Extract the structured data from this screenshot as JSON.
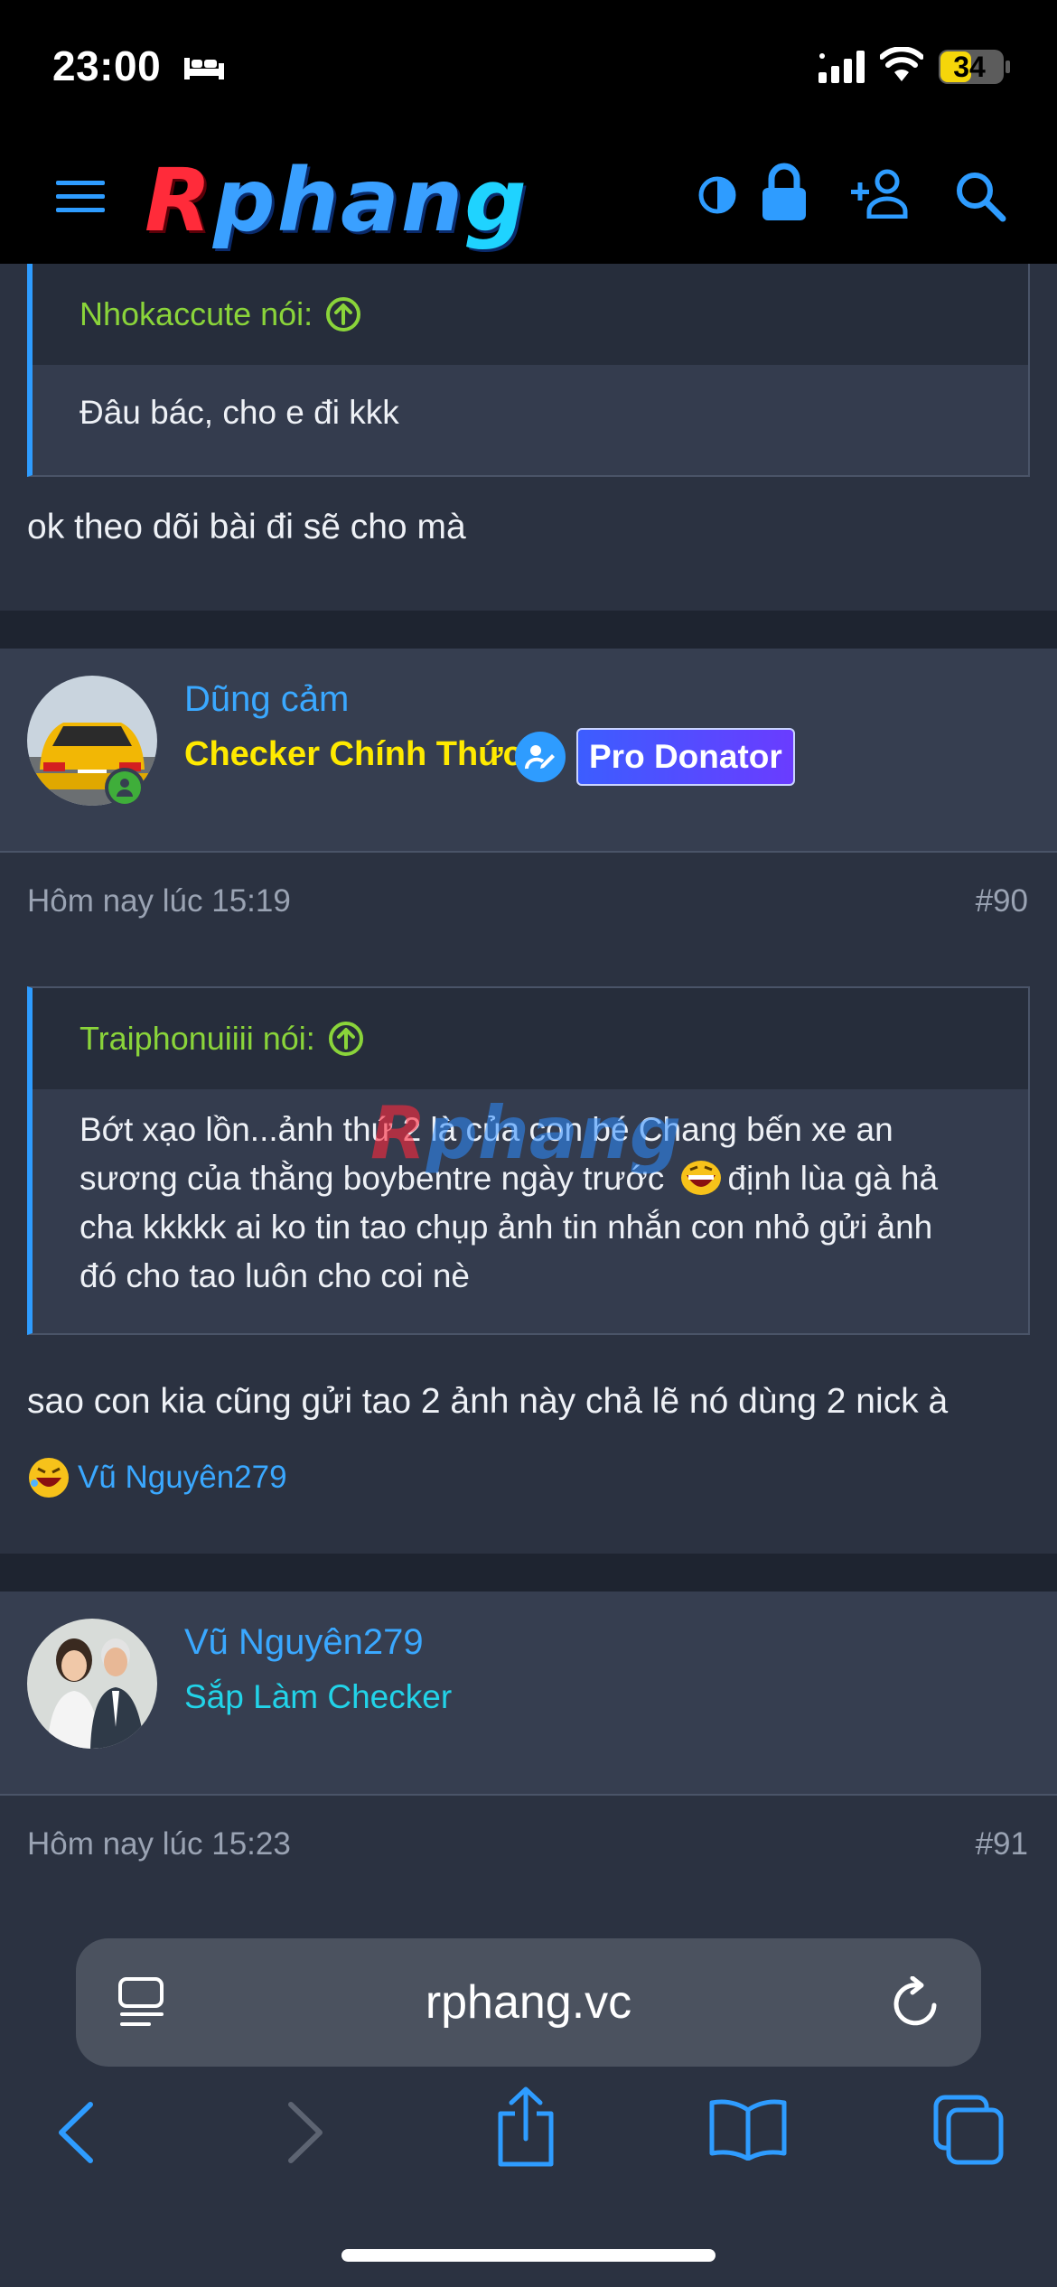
{
  "status_bar": {
    "time": "23:00",
    "battery": "34"
  },
  "nav": {
    "logo_r": "R",
    "logo_mid": "phan",
    "logo_g": "g",
    "icons": [
      "menu-icon",
      "theme-toggle-icon",
      "lock-icon",
      "add-user-icon",
      "search-icon"
    ]
  },
  "post1": {
    "quote_author": "Nhokaccute nói:",
    "quote_text": "Đâu bác, cho e đi kkk",
    "text": "ok theo dõi bài đi sẽ cho mà"
  },
  "post2": {
    "username": "Dũng cảm",
    "user_title": "Checker Chính Thức",
    "badge": "Pro Donator",
    "date": "Hôm nay lúc 15:19",
    "number": "#90",
    "quote_author": "Traiphonuiiii nói:",
    "quote_text_1": "Bớt xạo lồn...ảnh thứ 2 là của con bé Chang bến xe an",
    "quote_text_2a": "sương của thằng boybentre ngày trước",
    "quote_text_2b": "định lùa gà hả",
    "quote_text_3": "cha kkkkk ai ko tin tao chụp ảnh tin nhắn con nhỏ gửi ảnh",
    "quote_text_4": "đó cho tao luôn cho coi nè",
    "text": "sao con kia cũng gửi tao 2 ảnh này chả lẽ nó dùng 2 nick à",
    "reaction_user": "Vũ Nguyên279",
    "watermark_r": "R",
    "watermark_rest": "phang"
  },
  "post3": {
    "username": "Vũ Nguyên279",
    "user_title": "Sắp Làm Checker",
    "date": "Hôm nay lúc 15:23",
    "number": "#91"
  },
  "browser": {
    "url": "rphang.vc"
  },
  "colors": {
    "accent_blue": "#2e9cff",
    "quote_author_green": "#8ad43a",
    "title_gold": "#ffea00",
    "title_cyan": "#22d3e8",
    "page_bg": "#2b3241"
  }
}
